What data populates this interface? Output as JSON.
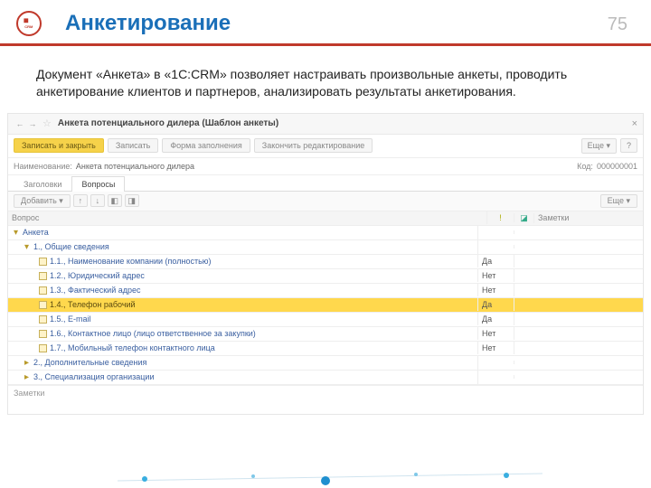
{
  "slide": {
    "title": "Анкетирование",
    "page": "75",
    "logo_label": "1C:CRM",
    "description": "Документ «Анкета» в «1С:CRM» позволяет настраивать произвольные анкеты,  проводить анкетирование клиентов и партнеров, анализировать результаты анкетирования."
  },
  "app": {
    "window_title": "Анкета потенциального дилера (Шаблон анкеты)",
    "toolbar": {
      "save_close": "Записать и закрыть",
      "save": "Записать",
      "fill_form": "Форма заполнения",
      "finish_edit": "Закончить редактирование",
      "more": "Еще",
      "help": "?"
    },
    "name_label": "Наименование:",
    "name_value": "Анкета потенциального дилера",
    "code_label": "Код:",
    "code_value": "000000001",
    "tabs": {
      "headers": "Заголовки",
      "questions": "Вопросы"
    },
    "subtoolbar": {
      "add": "Добавить",
      "more": "Еще"
    },
    "grid": {
      "col_question": "Вопрос",
      "col_notes": "Заметки",
      "rows": [
        {
          "level": 0,
          "icon": "expander",
          "text": "Анкета",
          "yn": "",
          "selected": false
        },
        {
          "level": 1,
          "icon": "expander",
          "text": "1., Общие сведения",
          "yn": "",
          "selected": false
        },
        {
          "level": 2,
          "icon": "file",
          "text": "1.1., Наименование компании (полностью)",
          "yn": "Да",
          "selected": false
        },
        {
          "level": 2,
          "icon": "file",
          "text": "1.2., Юридический адрес",
          "yn": "Нет",
          "selected": false
        },
        {
          "level": 2,
          "icon": "file",
          "text": "1.3., Фактический адрес",
          "yn": "Нет",
          "selected": false
        },
        {
          "level": 2,
          "icon": "file",
          "text": "1.4., Телефон рабочий",
          "yn": "Да",
          "selected": true
        },
        {
          "level": 2,
          "icon": "file",
          "text": "1.5., E-mail",
          "yn": "Да",
          "selected": false
        },
        {
          "level": 2,
          "icon": "file",
          "text": "1.6., Контактное лицо (лицо ответственное за закупки)",
          "yn": "Нет",
          "selected": false
        },
        {
          "level": 2,
          "icon": "file",
          "text": "1.7., Мобильный телефон контактного лица",
          "yn": "Нет",
          "selected": false
        },
        {
          "level": 1,
          "icon": "collapsed",
          "text": "2., Дополнительные сведения",
          "yn": "",
          "selected": false
        },
        {
          "level": 1,
          "icon": "collapsed",
          "text": "3., Специализация организации",
          "yn": "",
          "selected": false
        }
      ]
    },
    "notes_label": "Заметки"
  }
}
